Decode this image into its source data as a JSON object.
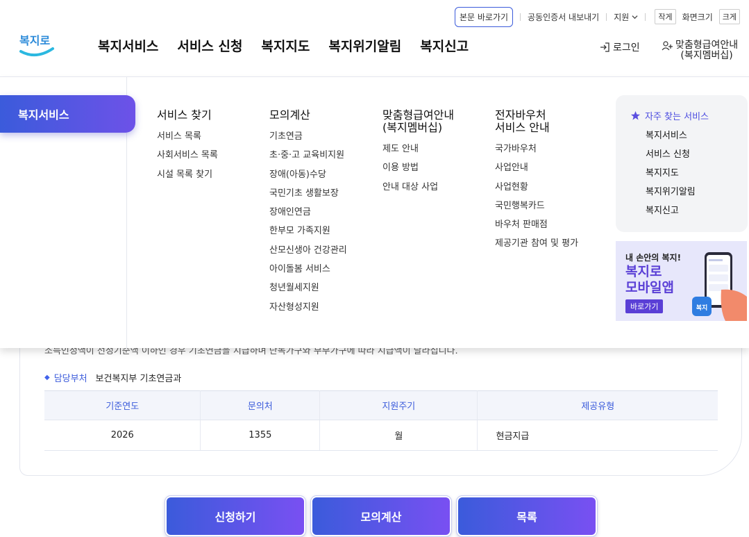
{
  "utility": {
    "skip_link": "본문 바로가기",
    "cert_export": "공동인증서 내보내기",
    "support": "지원",
    "font_small": "작게",
    "font_label": "화면크기",
    "font_large": "크게"
  },
  "header": {
    "logo_text": "복지로",
    "nav": [
      "복지서비스",
      "서비스 신청",
      "복지지도",
      "복지위기알림",
      "복지신고"
    ],
    "login": "로그인",
    "member_line1": "맞춤형급여안내",
    "member_line2": "(복지멤버십)"
  },
  "mega_menu": {
    "active": "복지서비스",
    "columns": [
      {
        "title": "서비스 찾기",
        "items": [
          "서비스 목록",
          "사회서비스 목록",
          "시설 목록 찾기"
        ]
      },
      {
        "title": "모의계산",
        "items": [
          "기초연금",
          "초·중·고 교육비지원",
          "장애(아동)수당",
          "국민기초 생활보장",
          "장애인연금",
          "한부모 가족지원",
          "산모신생아 건강관리",
          "아이돌봄 서비스",
          "청년월세지원",
          "자산형성지원"
        ]
      },
      {
        "title_line1": "맞춤형급여안내",
        "title_line2": "(복지멤버십)",
        "items": [
          "제도 안내",
          "이용 방법",
          "안내 대상 사업"
        ]
      },
      {
        "title_line1": "전자바우처",
        "title_line2": "서비스 안내",
        "items": [
          "국가바우처",
          "사업안내",
          "사업현황",
          "국민행복카드",
          "바우처 판매점",
          "제공기관 참여 및 평가"
        ]
      }
    ],
    "favorites": {
      "title": "자주 찾는 서비스",
      "items": [
        "복지서비스",
        "서비스 신청",
        "복지지도",
        "복지위기알림",
        "복지신고"
      ]
    },
    "banner": {
      "line1": "내 손안의 복지!",
      "line2": "복지로",
      "line3": "모바일앱",
      "button": "바로가기"
    }
  },
  "content": {
    "faded_text": "소득인정액이 선정기준액 이하인 경우 기초연금을 지급하며 단독가구와 부부가구에 따라 지급액이 달라집니다.",
    "dept_label": "담당부처",
    "dept_value": "보건복지부 기초연금과",
    "table": {
      "headers": [
        "기준연도",
        "문의처",
        "지원주기",
        "제공유형"
      ],
      "row": [
        "2026",
        "1355",
        "월",
        "현금지급"
      ]
    },
    "buttons": [
      "신청하기",
      "모의계산",
      "목록"
    ]
  },
  "colors": {
    "accent_blue": "#3b5bdb",
    "accent_purple": "#7950f2",
    "banner_bg": "#e7e7fb"
  }
}
